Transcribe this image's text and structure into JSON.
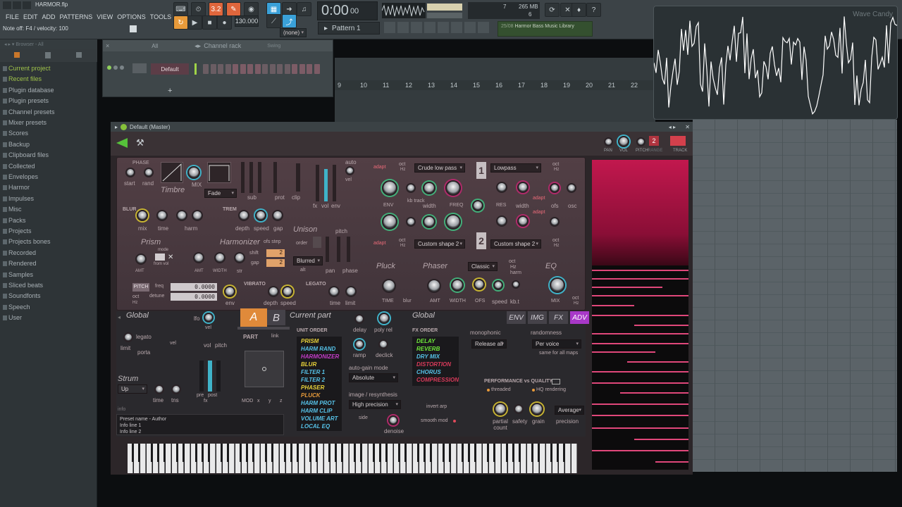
{
  "topbar": {
    "file_title": "HARMOR.flp",
    "menu": [
      "FILE",
      "EDIT",
      "ADD",
      "PATTERNS",
      "VIEW",
      "OPTIONS",
      "TOOLS",
      "?"
    ],
    "status_note": "Note off: F4 / velocity: 100",
    "pattern_num": "3.2",
    "tempo": "130.000",
    "snap": "(none)",
    "time": "0:00",
    "time_frac": "00",
    "cpu_num": "7",
    "mem": "265 MB",
    "voices": "6",
    "pattern": "Pattern 1",
    "news_date": "25/08",
    "news_text": "Harmor Bass Music Library"
  },
  "browser": {
    "header": "Browser - All",
    "items": [
      "Current project",
      "Recent files",
      "Plugin database",
      "Plugin presets",
      "Channel presets",
      "Mixer presets",
      "Scores",
      "Backup",
      "Clipboard files",
      "Collected",
      "Envelopes",
      "Harmor",
      "Impulses",
      "Misc",
      "Packs",
      "Projects",
      "Projects bones",
      "Recorded",
      "Rendered",
      "Samples",
      "Sliced beats",
      "Soundfonts",
      "Speech",
      "User"
    ]
  },
  "channel_rack": {
    "filter": "All",
    "title": "Channel rack",
    "swing": "Swing",
    "channel_name": "Default",
    "add": "+"
  },
  "playlist": {
    "ticks": [
      "9",
      "10",
      "11",
      "12",
      "13",
      "14",
      "15",
      "16",
      "17",
      "18",
      "19",
      "20",
      "21",
      "22"
    ]
  },
  "wave_candy": {
    "title": "Wave Candy"
  },
  "harmor": {
    "window_title": "Default (Master)",
    "top_labels": {
      "pan": "PAN",
      "vol": "VOL",
      "pitch": "PITCH",
      "range": "RANGE",
      "track": "TRACK",
      "track_num": "2"
    },
    "timbre": {
      "phase": "PHASE",
      "start": "start",
      "rand": "rand",
      "title": "Timbre",
      "mix": "MIX",
      "fade": "Fade",
      "sub": "sub",
      "prot": "prot",
      "clip": "clip",
      "fx": "fx",
      "vol": "vol",
      "env": "env",
      "auto": "auto",
      "vel": "vel"
    },
    "blur": {
      "title": "BLUR",
      "mix": "mix",
      "time": "time",
      "harm": "harm"
    },
    "trem": {
      "title": "TREM",
      "depth": "depth",
      "speed": "speed",
      "gap": "gap"
    },
    "unison": {
      "title": "Unison",
      "pitch": "pitch",
      "order": "order",
      "mode": "Blurred",
      "alt": "alt",
      "pan": "pan",
      "phase": "phase"
    },
    "prism": {
      "title": "Prism",
      "mode": "mode",
      "from_vol": "from vol",
      "amt": "AMT"
    },
    "harmonizer": {
      "title": "Harmonizer",
      "ofs_step": "ofs step",
      "shift": "shift",
      "gap": "gap",
      "amt": "AMT",
      "width": "WIDTH",
      "str": "str",
      "shift_val": "2",
      "gap_val": "2"
    },
    "pitch": {
      "title": "PITCH",
      "freq": "freq",
      "detune": "detune",
      "freq_val": "0.0000",
      "detune_val": "0.0000",
      "oct": "oct",
      "hz": "Hz",
      "env": "env"
    },
    "vibrato": {
      "title": "VIBRATO",
      "depth": "depth",
      "speed": "speed"
    },
    "legato": {
      "title": "LEGATO",
      "time": "time",
      "limit": "limit"
    },
    "filter": {
      "adapt": "adapt",
      "oct": "oct",
      "hz": "Hz",
      "type1": "Crude low pass",
      "type2": "Custom shape 2",
      "type3": "Lowpass",
      "type4": "Custom shape 2",
      "env": "ENV",
      "kb_track": "kb track",
      "width": "width",
      "freq": "FREQ",
      "res": "RES",
      "res_width": "width",
      "ofs": "ofs",
      "osc": "osc",
      "num1": "1",
      "num2": "2"
    },
    "pluck": {
      "title": "Pluck",
      "time": "TIME",
      "blur": "blur"
    },
    "phaser": {
      "title": "Phaser",
      "mode": "Classic",
      "amt": "AMT",
      "width": "WIDTH",
      "ofs": "OFS",
      "speed": "speed",
      "kbt": "kb.t",
      "oct": "oct",
      "hz": "Hz",
      "harm": "harm"
    },
    "eq": {
      "title": "EQ",
      "mix": "MIX",
      "oct": "oct",
      "hz": "Hz"
    },
    "global_left": {
      "title": "Global",
      "lfo": "lfo",
      "vel": "vel",
      "vol": "vol",
      "pitch": "pitch",
      "legato": "legato",
      "limit": "limit",
      "porta": "porta",
      "vel2": "vel",
      "strum": "Strum",
      "strum_mode": "Up",
      "time": "time",
      "tns": "tns",
      "pre": "pre",
      "post": "post",
      "fx": "fx"
    },
    "part": {
      "a": "A",
      "b": "B",
      "current": "Current part",
      "part": "PART",
      "link": "link",
      "mod": "MOD",
      "x": "x",
      "y": "y",
      "z": "z"
    },
    "info": {
      "label": "info",
      "lines": [
        "Preset name - Author",
        "Info line 1",
        "Info line 2"
      ]
    },
    "unit_order": {
      "title": "UNIT ORDER",
      "items": [
        {
          "name": "PRISM",
          "color": "#e8d23a"
        },
        {
          "name": "HARM RAND",
          "color": "#56c2e8"
        },
        {
          "name": "HARMONIZER",
          "color": "#c43cc8"
        },
        {
          "name": "BLUR",
          "color": "#e8d23a"
        },
        {
          "name": "FILTER 1",
          "color": "#56c2e8"
        },
        {
          "name": "FILTER 2",
          "color": "#56c2e8"
        },
        {
          "name": "PHASER",
          "color": "#e8d23a"
        },
        {
          "name": "PLUCK",
          "color": "#e89a3a"
        },
        {
          "name": "HARM PROT",
          "color": "#56c2e8"
        },
        {
          "name": "HARM CLIP",
          "color": "#56c2e8"
        },
        {
          "name": "VOLUME ART",
          "color": "#56c2e8"
        },
        {
          "name": "LOCAL EQ",
          "color": "#56c2e8"
        }
      ]
    },
    "gain": {
      "delay": "delay",
      "poly_rel": "poly rel",
      "ramp": "ramp",
      "declick": "declick",
      "auto_gain": "auto-gain mode",
      "auto_gain_val": "Absolute",
      "resynth": "image / resynthesis",
      "resynth_val": "High precision",
      "side": "side",
      "denoise": "denoise"
    },
    "fx_order": {
      "title": "FX ORDER",
      "items": [
        {
          "name": "DELAY",
          "color": "#6ee83a"
        },
        {
          "name": "REVERB",
          "color": "#6ee83a"
        },
        {
          "name": "DRY MIX",
          "color": "#56c2e8"
        },
        {
          "name": "DISTORTION",
          "color": "#d83a5a"
        },
        {
          "name": "CHORUS",
          "color": "#56c2e8"
        },
        {
          "name": "COMPRESSION",
          "color": "#d83a5a"
        }
      ]
    },
    "global_right": {
      "title": "Global",
      "tabs": [
        "ENV",
        "IMG",
        "FX",
        "ADV"
      ],
      "monophonic": "monophonic",
      "mono_val": "Release all",
      "randomness": "randomness",
      "rand_val": "Per voice",
      "same": "same for all maps",
      "perf": "PERFORMANCE vs QUALITY",
      "threaded": "threaded",
      "hq": "HQ rendering",
      "invert_arp": "invert arp",
      "smooth_mod": "smooth mod",
      "partial": "partial count",
      "safety": "safety",
      "grain": "grain",
      "precision": "precision",
      "precision_val": "Average"
    }
  },
  "colors": {
    "accent_orange": "#e0663c",
    "accent_blue": "#3aa1d9",
    "harmor_pink": "#e0477a",
    "browser_green": "#9fc24a"
  }
}
